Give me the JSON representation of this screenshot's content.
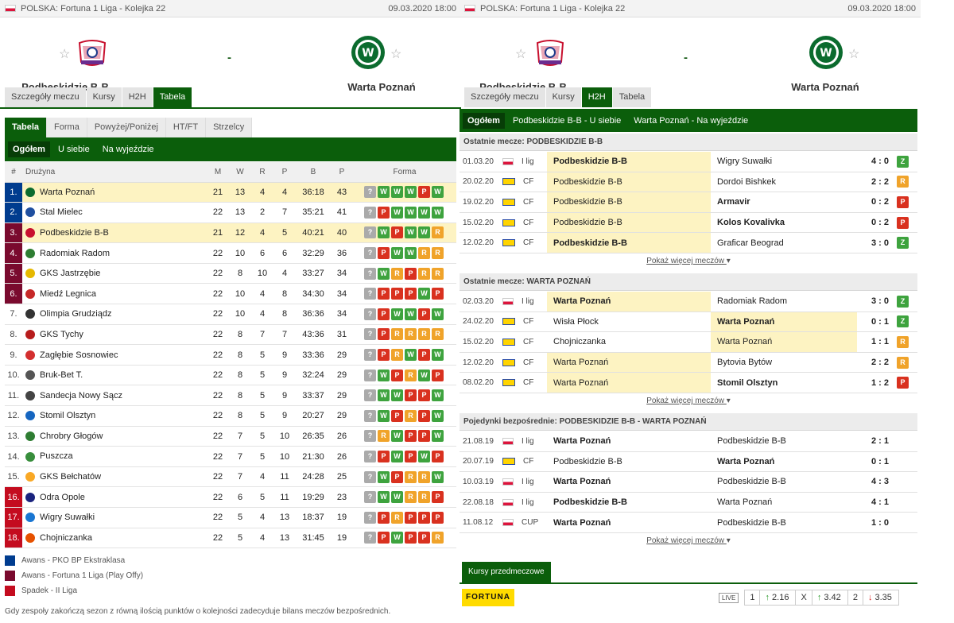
{
  "colors": {
    "win": "#3ea33e",
    "loss": "#d9311f",
    "draw": "#f0a32a",
    "unknown": "#aaaaaa",
    "promo": "#003c8f",
    "playoff": "#7a0a2e",
    "releg": "#c40c1f"
  },
  "left": {
    "competition": "POLSKA: Fortuna 1 Liga - Kolejka 22",
    "datetime": "09.03.2020 18:00",
    "home": "Podbeskidzie B-B",
    "away": "Warta Poznań",
    "score": "-",
    "tabs": [
      "Szczegóły meczu",
      "Kursy",
      "H2H",
      "Tabela"
    ],
    "subtabs": [
      "Tabela",
      "Forma",
      "Powyżej/Poniżej",
      "HT/FT",
      "Strzelcy"
    ],
    "filters": [
      "Ogółem",
      "U siebie",
      "Na wyjeździe"
    ],
    "headers": {
      "rank": "#",
      "team": "Drużyna",
      "m": "M",
      "w": "W",
      "d": "R",
      "l": "P",
      "g": "B",
      "p": "P",
      "form": "Forma"
    },
    "rows": [
      {
        "rank": "1.",
        "team": "Warta Poznań",
        "m": "21",
        "w": "13",
        "d": "4",
        "l": "4",
        "g": "36:18",
        "p": "43",
        "form": "?WWWPW",
        "zone": "promo",
        "hl": true
      },
      {
        "rank": "2.",
        "team": "Stal Mielec",
        "m": "22",
        "w": "13",
        "d": "2",
        "l": "7",
        "g": "35:21",
        "p": "41",
        "form": "?PWWWW",
        "zone": "promo",
        "hl": false
      },
      {
        "rank": "3.",
        "team": "Podbeskidzie B-B",
        "m": "21",
        "w": "12",
        "d": "4",
        "l": "5",
        "g": "40:21",
        "p": "40",
        "form": "?WPWWR",
        "zone": "playoff",
        "hl": true
      },
      {
        "rank": "4.",
        "team": "Radomiak Radom",
        "m": "22",
        "w": "10",
        "d": "6",
        "l": "6",
        "g": "32:29",
        "p": "36",
        "form": "?PWWRR",
        "zone": "playoff",
        "hl": false
      },
      {
        "rank": "5.",
        "team": "GKS Jastrzębie",
        "m": "22",
        "w": "8",
        "d": "10",
        "l": "4",
        "g": "33:27",
        "p": "34",
        "form": "?WRPRR",
        "zone": "playoff",
        "hl": false
      },
      {
        "rank": "6.",
        "team": "Miedź Legnica",
        "m": "22",
        "w": "10",
        "d": "4",
        "l": "8",
        "g": "34:30",
        "p": "34",
        "form": "?PPPWP",
        "zone": "playoff",
        "hl": false
      },
      {
        "rank": "7.",
        "team": "Olimpia Grudziądz",
        "m": "22",
        "w": "10",
        "d": "4",
        "l": "8",
        "g": "36:36",
        "p": "34",
        "form": "?PWWPW",
        "zone": "",
        "hl": false
      },
      {
        "rank": "8.",
        "team": "GKS Tychy",
        "m": "22",
        "w": "8",
        "d": "7",
        "l": "7",
        "g": "43:36",
        "p": "31",
        "form": "?PRRRR",
        "zone": "",
        "hl": false
      },
      {
        "rank": "9.",
        "team": "Zagłębie Sosnowiec",
        "m": "22",
        "w": "8",
        "d": "5",
        "l": "9",
        "g": "33:36",
        "p": "29",
        "form": "?PRWPW",
        "zone": "",
        "hl": false
      },
      {
        "rank": "10.",
        "team": "Bruk-Bet T.",
        "m": "22",
        "w": "8",
        "d": "5",
        "l": "9",
        "g": "32:24",
        "p": "29",
        "form": "?WPRWP",
        "zone": "",
        "hl": false
      },
      {
        "rank": "11.",
        "team": "Sandecja Nowy Sącz",
        "m": "22",
        "w": "8",
        "d": "5",
        "l": "9",
        "g": "33:37",
        "p": "29",
        "form": "?WWPPW",
        "zone": "",
        "hl": false
      },
      {
        "rank": "12.",
        "team": "Stomil Olsztyn",
        "m": "22",
        "w": "8",
        "d": "5",
        "l": "9",
        "g": "20:27",
        "p": "29",
        "form": "?WPRPW",
        "zone": "",
        "hl": false
      },
      {
        "rank": "13.",
        "team": "Chrobry Głogów",
        "m": "22",
        "w": "7",
        "d": "5",
        "l": "10",
        "g": "26:35",
        "p": "26",
        "form": "?RWPPW",
        "zone": "",
        "hl": false
      },
      {
        "rank": "14.",
        "team": "Puszcza",
        "m": "22",
        "w": "7",
        "d": "5",
        "l": "10",
        "g": "21:30",
        "p": "26",
        "form": "?PWPWP",
        "zone": "",
        "hl": false
      },
      {
        "rank": "15.",
        "team": "GKS Bełchatów",
        "m": "22",
        "w": "7",
        "d": "4",
        "l": "11",
        "g": "24:28",
        "p": "25",
        "form": "?WPRRW",
        "zone": "",
        "hl": false
      },
      {
        "rank": "16.",
        "team": "Odra Opole",
        "m": "22",
        "w": "6",
        "d": "5",
        "l": "11",
        "g": "19:29",
        "p": "23",
        "form": "?WWRRP",
        "zone": "releg",
        "hl": false
      },
      {
        "rank": "17.",
        "team": "Wigry Suwałki",
        "m": "22",
        "w": "5",
        "d": "4",
        "l": "13",
        "g": "18:37",
        "p": "19",
        "form": "?PRPPP",
        "zone": "releg",
        "hl": false
      },
      {
        "rank": "18.",
        "team": "Chojniczanka",
        "m": "22",
        "w": "5",
        "d": "4",
        "l": "13",
        "g": "31:45",
        "p": "19",
        "form": "?PWPPR",
        "zone": "releg",
        "hl": false
      }
    ],
    "legend": [
      "Awans - PKO BP Ekstraklasa",
      "Awans - Fortuna 1 Liga (Play Offy)",
      "Spadek - II Liga"
    ],
    "note": "Gdy zespoły zakończą sezon z równą ilością punktów o kolejności zadecyduje bilans meczów bezpośrednich."
  },
  "right": {
    "competition": "POLSKA: Fortuna 1 Liga - Kolejka 22",
    "datetime": "09.03.2020 18:00",
    "home": "Podbeskidzie B-B",
    "away": "Warta Poznań",
    "score": "-",
    "tabs": [
      "Szczegóły meczu",
      "Kursy",
      "H2H",
      "Tabela"
    ],
    "filters": [
      "Ogółem",
      "Podbeskidzie B-B - U siebie",
      "Warta Poznań - Na wyjeździe"
    ],
    "sections": [
      {
        "title": "Ostatnie mecze: PODBESKIDZIE B-B",
        "more": "Pokaż więcej meczów",
        "rows": [
          {
            "date": "01.03.20",
            "comp": "I lig",
            "flag": "pl",
            "home": "Podbeskidzie B-B",
            "away": "Wigry Suwałki",
            "score": "4 : 0",
            "res": "Z",
            "hb": true,
            "ab": false,
            "hl": "home"
          },
          {
            "date": "20.02.20",
            "comp": "CF",
            "flag": "cf",
            "home": "Podbeskidzie B-B",
            "away": "Dordoi Bishkek",
            "score": "2 : 2",
            "res": "R",
            "hb": false,
            "ab": false,
            "hl": "home"
          },
          {
            "date": "19.02.20",
            "comp": "CF",
            "flag": "cf",
            "home": "Podbeskidzie B-B",
            "away": "Armavir",
            "score": "0 : 2",
            "res": "P",
            "hb": false,
            "ab": true,
            "hl": "home"
          },
          {
            "date": "15.02.20",
            "comp": "CF",
            "flag": "cf",
            "home": "Podbeskidzie B-B",
            "away": "Kolos Kovalivka",
            "score": "0 : 2",
            "res": "P",
            "hb": false,
            "ab": true,
            "hl": "home"
          },
          {
            "date": "12.02.20",
            "comp": "CF",
            "flag": "cf",
            "home": "Podbeskidzie B-B",
            "away": "Graficar Beograd",
            "score": "3 : 0",
            "res": "Z",
            "hb": true,
            "ab": false,
            "hl": "home"
          }
        ]
      },
      {
        "title": "Ostatnie mecze: WARTA POZNAŃ",
        "more": "Pokaż więcej meczów",
        "rows": [
          {
            "date": "02.03.20",
            "comp": "I lig",
            "flag": "pl",
            "home": "Warta Poznań",
            "away": "Radomiak Radom",
            "score": "3 : 0",
            "res": "Z",
            "hb": true,
            "ab": false,
            "hl": "home"
          },
          {
            "date": "24.02.20",
            "comp": "CF",
            "flag": "cf",
            "home": "Wisła Płock",
            "away": "Warta Poznań",
            "score": "0 : 1",
            "res": "Z",
            "hb": false,
            "ab": true,
            "hl": "away"
          },
          {
            "date": "15.02.20",
            "comp": "CF",
            "flag": "cf",
            "home": "Chojniczanka",
            "away": "Warta Poznań",
            "score": "1 : 1",
            "res": "R",
            "hb": false,
            "ab": false,
            "hl": "away"
          },
          {
            "date": "12.02.20",
            "comp": "CF",
            "flag": "cf",
            "home": "Warta Poznań",
            "away": "Bytovia Bytów",
            "score": "2 : 2",
            "res": "R",
            "hb": false,
            "ab": false,
            "hl": "home"
          },
          {
            "date": "08.02.20",
            "comp": "CF",
            "flag": "cf",
            "home": "Warta Poznań",
            "away": "Stomil Olsztyn",
            "score": "1 : 2",
            "res": "P",
            "hb": false,
            "ab": true,
            "hl": "home"
          }
        ]
      },
      {
        "title": "Pojedynki bezpośrednie: PODBESKIDZIE B-B - WARTA POZNAŃ",
        "more": "Pokaż więcej meczów",
        "rows": [
          {
            "date": "21.08.19",
            "comp": "I lig",
            "flag": "pl",
            "home": "Warta Poznań",
            "away": "Podbeskidzie B-B",
            "score": "2 : 1",
            "res": "",
            "hb": true,
            "ab": false,
            "hl": ""
          },
          {
            "date": "20.07.19",
            "comp": "CF",
            "flag": "cf",
            "home": "Podbeskidzie B-B",
            "away": "Warta Poznań",
            "score": "0 : 1",
            "res": "",
            "hb": false,
            "ab": true,
            "hl": ""
          },
          {
            "date": "10.03.19",
            "comp": "I lig",
            "flag": "pl",
            "home": "Warta Poznań",
            "away": "Podbeskidzie B-B",
            "score": "4 : 3",
            "res": "",
            "hb": true,
            "ab": false,
            "hl": ""
          },
          {
            "date": "22.08.18",
            "comp": "I lig",
            "flag": "pl",
            "home": "Podbeskidzie B-B",
            "away": "Warta Poznań",
            "score": "4 : 1",
            "res": "",
            "hb": true,
            "ab": false,
            "hl": ""
          },
          {
            "date": "11.08.12",
            "comp": "CUP",
            "flag": "pl",
            "home": "Warta Poznań",
            "away": "Podbeskidzie B-B",
            "score": "1 : 0",
            "res": "",
            "hb": true,
            "ab": false,
            "hl": ""
          }
        ]
      }
    ],
    "odds": {
      "tab": "Kursy przedmeczowe",
      "bookmaker": "FORTUNA",
      "live": "LIVE",
      "l1": "1",
      "o1": "2.16",
      "lx": "X",
      "ox": "3.42",
      "l2": "2",
      "o2": "3.35",
      "a1": "↑",
      "ax": "↑",
      "a2": "↓"
    }
  }
}
